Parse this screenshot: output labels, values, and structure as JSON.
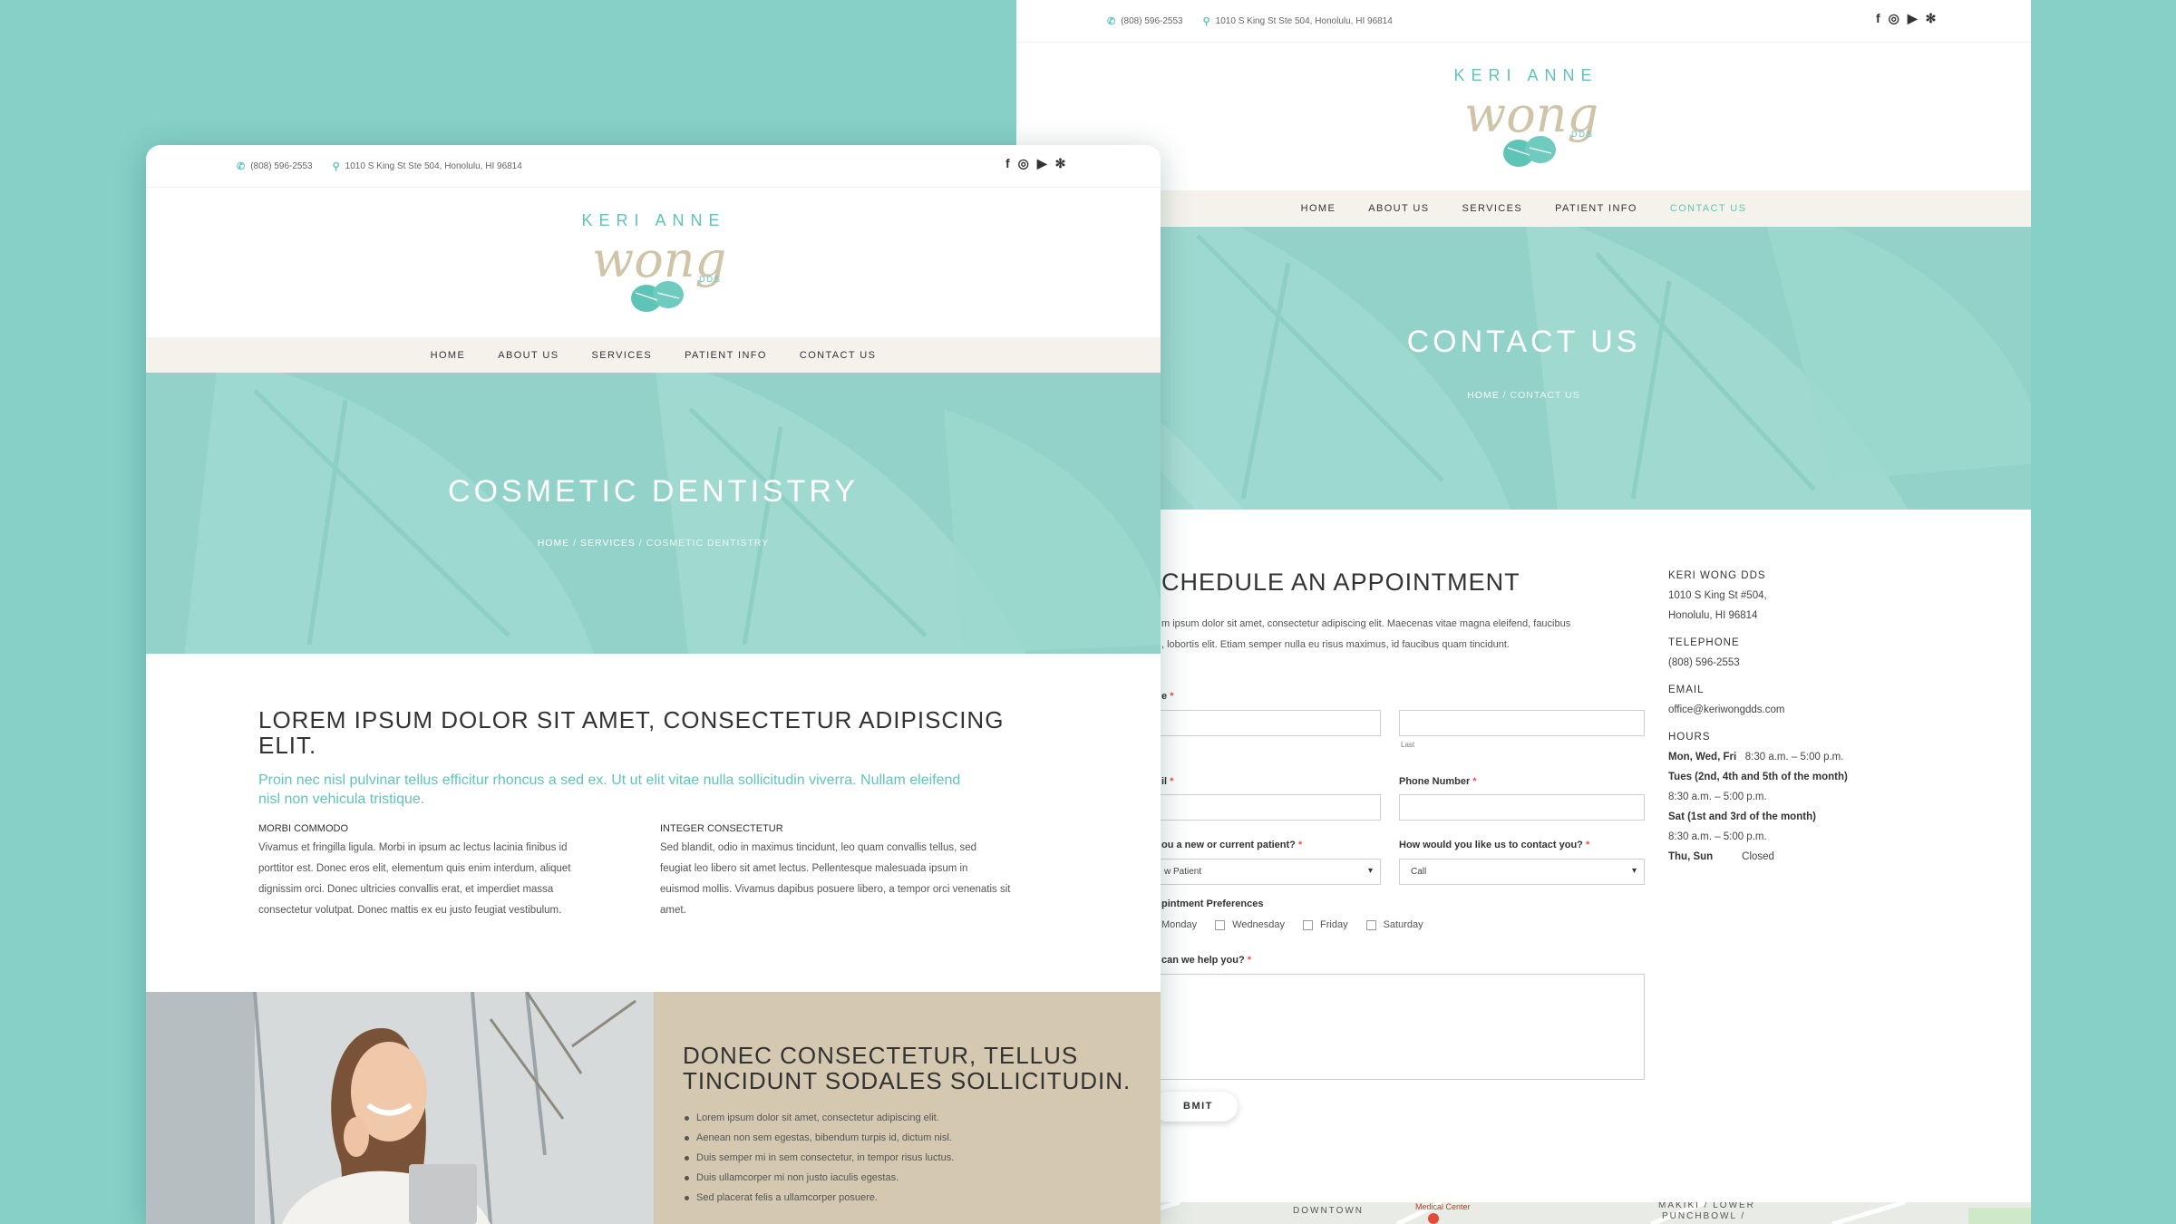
{
  "back_page": {
    "topbar": {
      "phone": "(808) 596-2553",
      "address": "1010 S King St Ste 504, Honolulu, HI 96814"
    },
    "logo": {
      "line1": "KERI ANNE",
      "script": "wong",
      "suffix": "DDS"
    },
    "nav": [
      "HOME",
      "ABOUT US",
      "SERVICES",
      "PATIENT INFO",
      "CONTACT US"
    ],
    "hero": {
      "title": "CONTACT US",
      "crumb_home": "HOME",
      "crumb_sep": " / ",
      "crumb_current": "CONTACT US"
    },
    "form": {
      "heading": "CHEDULE AN APPOINTMENT",
      "intro1": "m ipsum dolor sit amet, consectetur adipiscing elit. Maecenas vitae magna eleifend, faucibus",
      "intro2": ", lobortis elit. Etiam semper nulla eu risus maximus, id faucibus quam tincidunt.",
      "name_label": "e",
      "name_sub_last": "Last",
      "email_label": "il",
      "phone_label": "Phone Number",
      "patient_label": "ou a new or current patient?",
      "patient_value": "w Patient",
      "contact_label": "How would you like us to contact you?",
      "contact_value": "Call",
      "pref_label": "pintment Preferences",
      "days": [
        "Monday",
        "Wednesday",
        "Friday",
        "Saturday"
      ],
      "help_label": " can we help you?",
      "submit": "BMIT"
    },
    "info": {
      "name": "KERI WONG DDS",
      "addr1": "1010 S King St #504,",
      "addr2": "Honolulu, HI 96814",
      "tel_h": "TELEPHONE",
      "tel": "(808) 596-2553",
      "email_h": "EMAIL",
      "email": "office@keriwongdds.com",
      "hours_h": "HOURS",
      "h1_day": "Mon, Wed, Fri",
      "h1_time": "8:30 a.m. – 5:00 p.m.",
      "h2_day": "Tues (2nd, 4th and 5th of the month)",
      "h2_time": "8:30 a.m. – 5:00 p.m.",
      "h3_day": "Sat (1st and 3rd of the month)",
      "h3_time": "8:30 a.m. – 5:00 p.m.",
      "h4_day": "Thu, Sun",
      "h4_time": "Closed"
    },
    "map": {
      "l1": "DOWNTOWN",
      "l2": "Medical Center",
      "l3": "MAKIKI / LOWER",
      "l4": "PUNCHBOWL /"
    }
  },
  "front_page": {
    "topbar": {
      "phone": "(808) 596-2553",
      "address": "1010 S King St Ste 504, Honolulu, HI 96814"
    },
    "logo": {
      "line1": "KERI ANNE",
      "script": "wong",
      "suffix": "DDS"
    },
    "nav": [
      "HOME",
      "ABOUT US",
      "SERVICES",
      "PATIENT INFO",
      "CONTACT US"
    ],
    "hero": {
      "title": "COSMETIC DENTISTRY",
      "crumb_home": "HOME",
      "crumb_sep": " / ",
      "crumb_mid": "SERVICES",
      "crumb_current": "COSMETIC DENTISTRY"
    },
    "intro": {
      "heading1": "LOREM IPSUM DOLOR SIT AMET, CONSECTETUR ADIPISCING",
      "heading2": "ELIT.",
      "lead1": "Proin nec nisl pulvinar tellus efficitur rhoncus a sed ex. Ut ut elit vitae nulla sollicitudin viverra. Nullam eleifend",
      "lead2": "nisl non vehicula tristique.",
      "col1_title": "MORBI COMMODO",
      "col1_lines": [
        "Vivamus et fringilla ligula. Morbi in ipsum ac lectus lacinia finibus id",
        "porttitor est. Donec eros elit, elementum quis enim interdum, aliquet",
        "dignissim orci. Donec ultricies convallis erat, et imperdiet massa",
        "consectetur volutpat. Donec mattis ex eu justo feugiat vestibulum."
      ],
      "col2_title": "INTEGER CONSECTETUR",
      "col2_lines": [
        "Sed blandit, odio in maximus tincidunt, leo quam convallis tellus, sed",
        "feugiat leo libero sit amet lectus. Pellentesque malesuada ipsum in",
        "euismod mollis. Vivamus dapibus posuere libero, a tempor orci venenatis sit",
        "amet."
      ]
    },
    "feature": {
      "heading1": "DONEC CONSECTETUR, TELLUS",
      "heading2": "TINCIDUNT SODALES SOLLICITUDIN.",
      "bullets": [
        "Lorem ipsum dolor sit amet, consectetur adipiscing elit.",
        "Aenean non sem egestas, bibendum turpis id, dictum nisl.",
        "Duis semper mi in sem consectetur, in tempor risus luctus.",
        "Duis ullamcorper mi non justo iaculis egestas.",
        "Sed placerat felis a ullamcorper posuere."
      ]
    }
  },
  "colors": {
    "background": "#86d0c8",
    "teal": "#5fc4b8",
    "beige": "#d4c8b0",
    "nav_bg": "#f5f2ec",
    "hero": "#92d2c9"
  }
}
